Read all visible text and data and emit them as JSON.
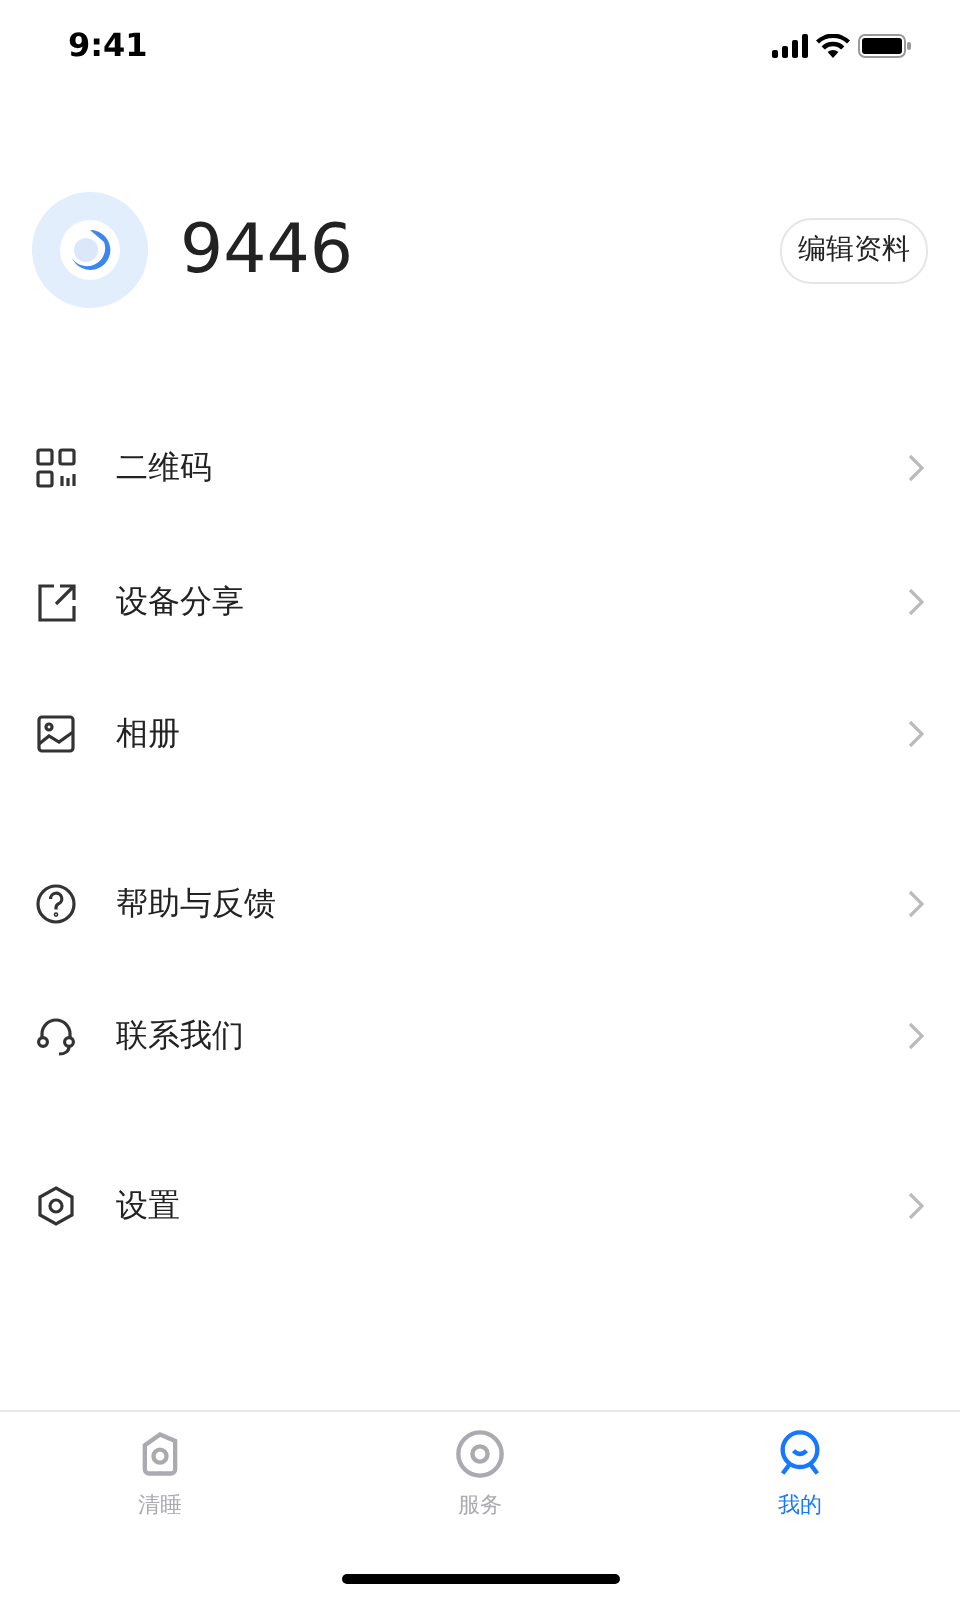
{
  "status_bar": {
    "time": "9:41"
  },
  "profile": {
    "name": "9446",
    "edit_button": "编辑资料"
  },
  "menu_groups": [
    {
      "items": [
        {
          "label": "二维码"
        },
        {
          "label": "设备分享"
        },
        {
          "label": "相册"
        }
      ]
    },
    {
      "items": [
        {
          "label": "帮助与反馈"
        },
        {
          "label": "联系我们"
        }
      ]
    },
    {
      "items": [
        {
          "label": "设置"
        }
      ]
    }
  ],
  "tab_bar": [
    {
      "label": "清睡",
      "selected": false
    },
    {
      "label": "服务",
      "selected": false
    },
    {
      "label": "我的",
      "selected": true
    }
  ]
}
